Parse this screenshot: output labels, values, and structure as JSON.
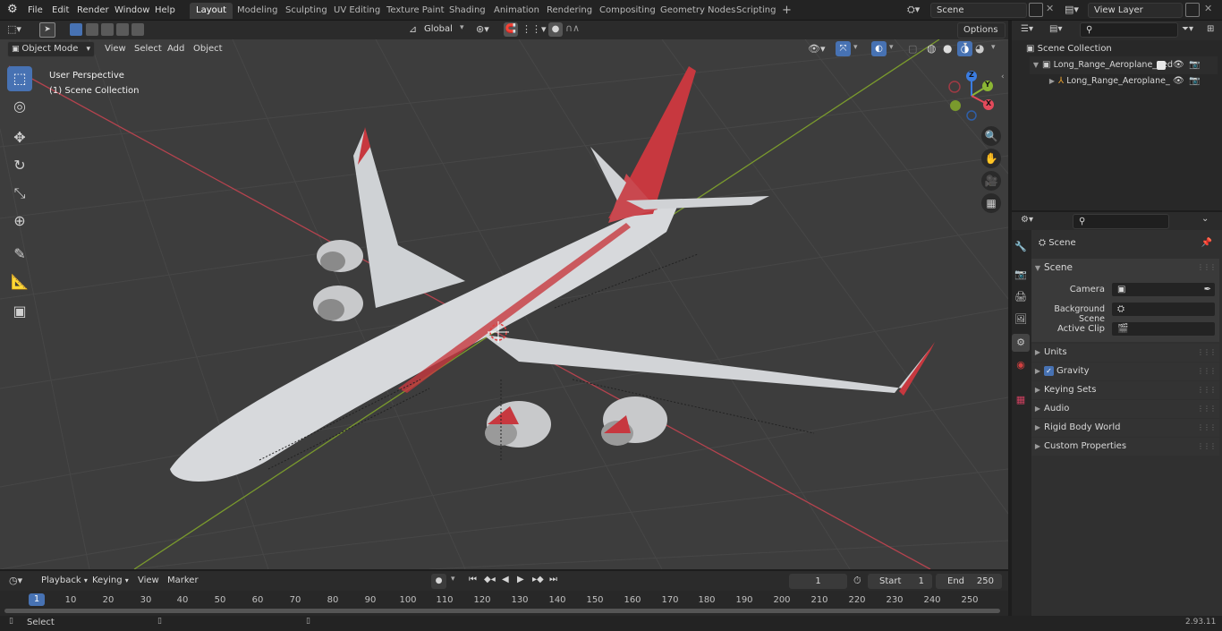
{
  "topbar": {
    "menus": [
      "File",
      "Edit",
      "Render",
      "Window",
      "Help"
    ],
    "workspaces": [
      "Layout",
      "Modeling",
      "Sculpting",
      "UV Editing",
      "Texture Paint",
      "Shading",
      "Animation",
      "Rendering",
      "Compositing",
      "Geometry Nodes",
      "Scripting"
    ],
    "active_workspace": "Layout",
    "add_tab": "+",
    "scene_name": "Scene",
    "view_layer": "View Layer"
  },
  "viewport_header": {
    "mode": "Object Mode",
    "menus": [
      "View",
      "Select",
      "Add",
      "Object"
    ],
    "orientation": "Global",
    "options": "Options"
  },
  "viewport": {
    "perspective_label": "User Perspective",
    "collection_label": "(1) Scene Collection",
    "axes": {
      "x": "X",
      "y": "Y",
      "z": "Z"
    },
    "colors": {
      "x_axis": "#e34a5b",
      "y_axis": "#8bb534",
      "z_axis": "#3b7ce0",
      "grid": "#474747",
      "background": "#3d3d3d",
      "active_tool": "#4772b3"
    }
  },
  "outliner": {
    "root": "Scene Collection",
    "items": [
      {
        "label": "Long_Range_Aeroplane_Red",
        "type": "collection"
      },
      {
        "label": "Long_Range_Aeroplane_",
        "type": "object"
      }
    ]
  },
  "properties": {
    "context": "Scene",
    "panel_title": "Scene",
    "fields": [
      {
        "label": "Camera",
        "value": ""
      },
      {
        "label": "Background Scene",
        "value": ""
      },
      {
        "label": "Active Clip",
        "value": ""
      }
    ],
    "subpanels": [
      "Units",
      "Gravity",
      "Keying Sets",
      "Audio",
      "Rigid Body World",
      "Custom Properties"
    ],
    "gravity_checked": true
  },
  "timeline": {
    "menus": [
      "Playback",
      "Keying",
      "View",
      "Marker"
    ],
    "current_frame": "1",
    "start_label": "Start",
    "start": "1",
    "end_label": "End",
    "end": "250",
    "ticks": [
      "1",
      "10",
      "20",
      "30",
      "40",
      "50",
      "60",
      "70",
      "80",
      "90",
      "100",
      "110",
      "120",
      "130",
      "140",
      "150",
      "160",
      "170",
      "180",
      "190",
      "200",
      "210",
      "220",
      "230",
      "240",
      "250"
    ]
  },
  "statusbar": {
    "left": "Select",
    "version": "2.93.11"
  }
}
